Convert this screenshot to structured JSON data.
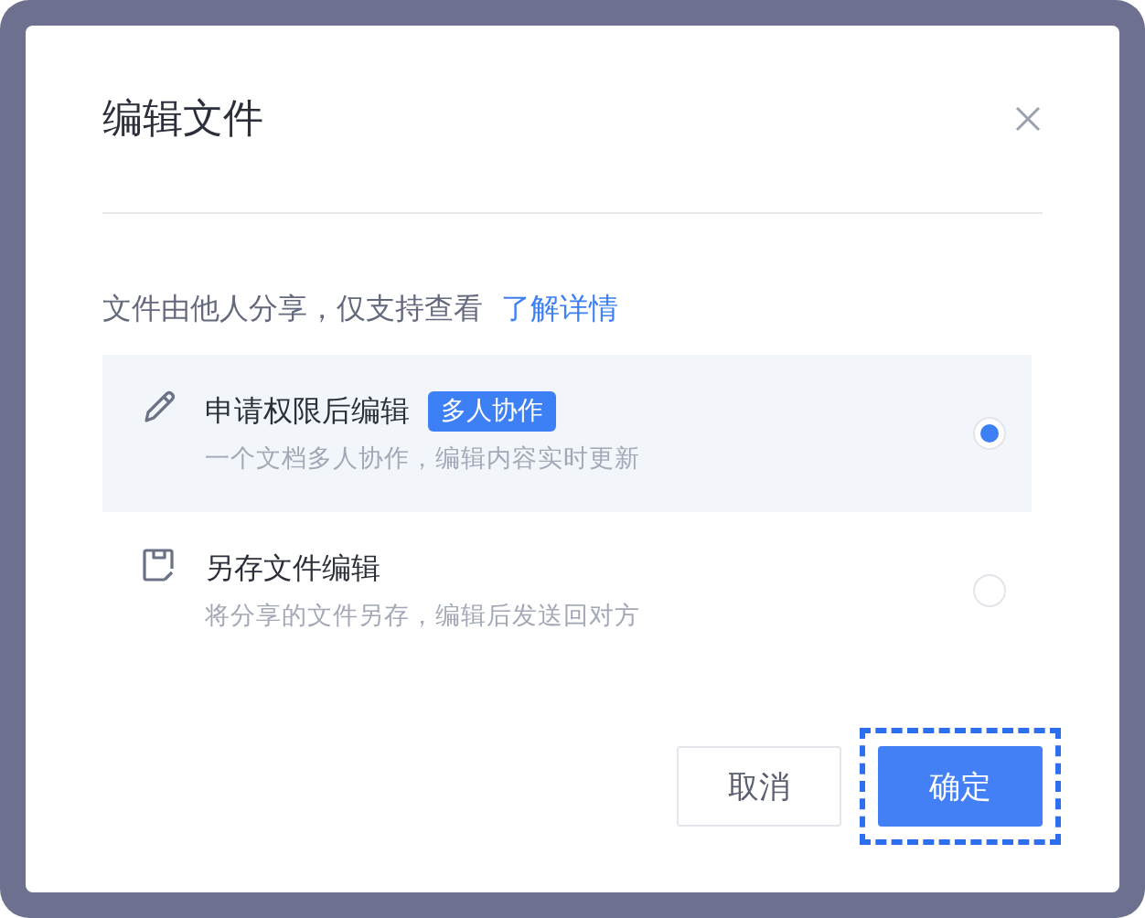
{
  "dialog": {
    "title": "编辑文件",
    "notice": "文件由他人分享，仅支持查看",
    "notice_link": "了解详情",
    "options": [
      {
        "kind": "edit",
        "title": "申请权限后编辑",
        "tag": "多人协作",
        "description": "一个文档多人协作，编辑内容实时更新",
        "selected": true
      },
      {
        "kind": "copy",
        "title": "另存文件编辑",
        "description": "将分享的文件另存，编辑后发送回对方",
        "selected": false
      }
    ],
    "buttons": [
      {
        "label": "取消",
        "kind": "secondary",
        "focused": false
      },
      {
        "label": "确定",
        "kind": "primary",
        "focused": true
      }
    ]
  }
}
